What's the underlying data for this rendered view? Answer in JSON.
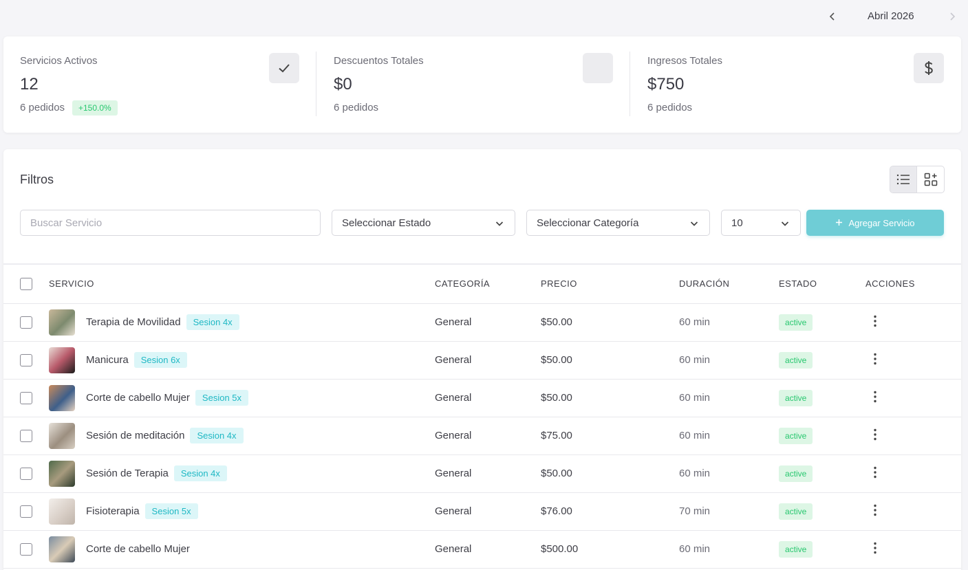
{
  "month_nav": {
    "label": "Abril 2026"
  },
  "stats": [
    {
      "title": "Servicios Activos",
      "value": "12",
      "sub": "6 pedidos",
      "badge": "+150.0%",
      "icon": "check-icon"
    },
    {
      "title": "Descuentos Totales",
      "value": "$0",
      "sub": "6 pedidos",
      "icon": "blank-icon"
    },
    {
      "title": "Ingresos Totales",
      "value": "$750",
      "sub": "6 pedidos",
      "icon": "dollar-icon"
    }
  ],
  "filters": {
    "title": "Filtros",
    "search_placeholder": "Buscar Servicio",
    "state_select": "Seleccionar Estado",
    "category_select": "Seleccionar Categoría",
    "page_size": "10",
    "add_button": "Agregar Servicio"
  },
  "table": {
    "headers": {
      "service": "SERVICIO",
      "category": "CATEGORÍA",
      "price": "PRECIO",
      "duration": "DURACIÓN",
      "state": "ESTADO",
      "actions": "ACCIONES"
    },
    "rows": [
      {
        "name": "Terapia de Movilidad",
        "session": "Sesion 4x",
        "category": "General",
        "price": "$50.00",
        "duration": "60 min",
        "state": "active"
      },
      {
        "name": "Manicura",
        "session": "Sesion 6x",
        "category": "General",
        "price": "$50.00",
        "duration": "60 min",
        "state": "active"
      },
      {
        "name": "Corte de cabello Mujer",
        "session": "Sesion 5x",
        "category": "General",
        "price": "$50.00",
        "duration": "60 min",
        "state": "active"
      },
      {
        "name": "Sesión de meditación",
        "session": "Sesion 4x",
        "category": "General",
        "price": "$75.00",
        "duration": "60 min",
        "state": "active"
      },
      {
        "name": "Sesión de Terapia",
        "session": "Sesion 4x",
        "category": "General",
        "price": "$50.00",
        "duration": "60 min",
        "state": "active"
      },
      {
        "name": "Fisioterapia",
        "session": "Sesion 5x",
        "category": "General",
        "price": "$76.00",
        "duration": "70 min",
        "state": "active"
      },
      {
        "name": "Corte de cabello Mujer",
        "session": "",
        "category": "General",
        "price": "$500.00",
        "duration": "60 min",
        "state": "active"
      }
    ]
  },
  "colors": {
    "accent": "#6fcdd6",
    "success": "#28c76f",
    "success_bg": "#ddf6e5",
    "info": "#1fb8c4",
    "info_bg": "#dcf6f8"
  }
}
